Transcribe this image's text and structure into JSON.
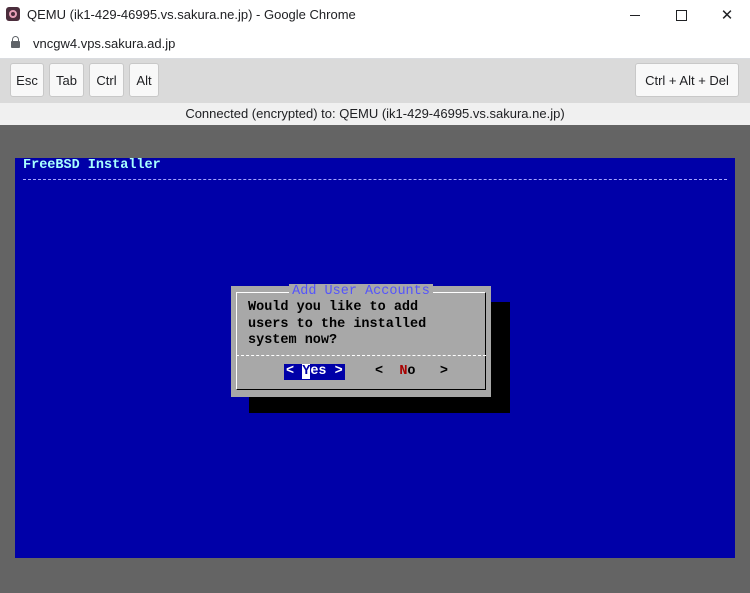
{
  "browser": {
    "window_title": "QEMU (ik1-429-46995.vs.sakura.ne.jp) - Google Chrome",
    "url": "vncgw4.vps.sakura.ad.jp",
    "minimize_symbol": "",
    "maximize_symbol": "",
    "close_symbol": "✕"
  },
  "keys": {
    "esc": "Esc",
    "tab": "Tab",
    "ctrl": "Ctrl",
    "alt": "Alt",
    "ctrl_alt_del": "Ctrl + Alt + Del"
  },
  "status": "Connected (encrypted) to: QEMU (ik1-429-46995.vs.sakura.ne.jp)",
  "console": {
    "installer_title": "FreeBSD Installer",
    "dialog": {
      "title": "Add User Accounts",
      "message": "Would you like to add\nusers to the installed\nsystem now?",
      "yes_open": "< ",
      "yes_hotkey": "Y",
      "yes_rest": "es >",
      "no_open": "<  ",
      "no_hotkey": "N",
      "no_rest": "o   >"
    }
  }
}
